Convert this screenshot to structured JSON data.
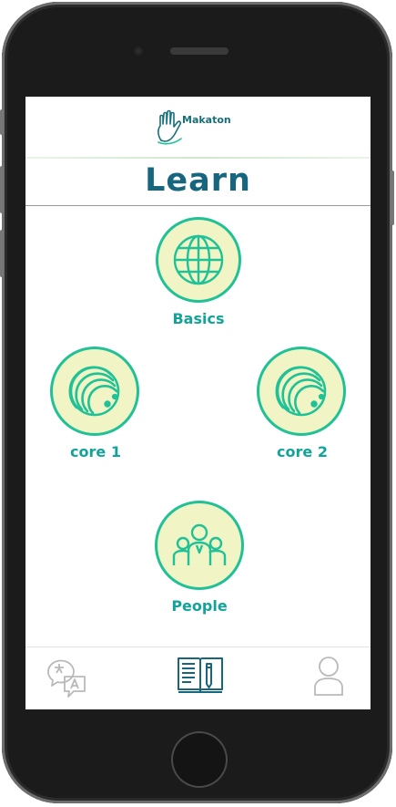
{
  "app": {
    "logo_text": "Makaton"
  },
  "page": {
    "title": "Learn"
  },
  "lessons": [
    {
      "label": "Basics",
      "icon": "globe-icon"
    },
    {
      "label": "core 1",
      "icon": "planet-icon"
    },
    {
      "label": "core 2",
      "icon": "planet-icon"
    },
    {
      "label": "People",
      "icon": "people-icon"
    }
  ],
  "tabbar": {
    "items": [
      {
        "icon": "translate-icon",
        "selected": false
      },
      {
        "icon": "book-icon",
        "selected": true
      },
      {
        "icon": "user-icon",
        "selected": false
      }
    ]
  },
  "colors": {
    "title": "#17667e",
    "accent": "#20c197",
    "label": "#13a399",
    "circle_fill": "#f1f5c6",
    "tab_inactive": "#b9b9b9"
  }
}
